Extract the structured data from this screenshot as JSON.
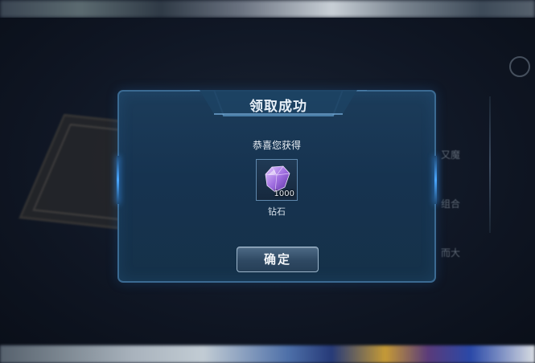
{
  "dialog": {
    "title": "领取成功",
    "message": "恭喜您获得",
    "confirm_label": "确定"
  },
  "reward": {
    "name": "钻石",
    "quantity": "1000",
    "icon": "purple-gem-icon"
  },
  "background": {
    "side_labels": [
      "又魔",
      "组合",
      "而大"
    ]
  },
  "colors": {
    "dialog_bg": "#163350",
    "dialog_border": "#3b6a92",
    "accent_glow": "#4aa7ff",
    "gem": "#9b6ad8"
  }
}
